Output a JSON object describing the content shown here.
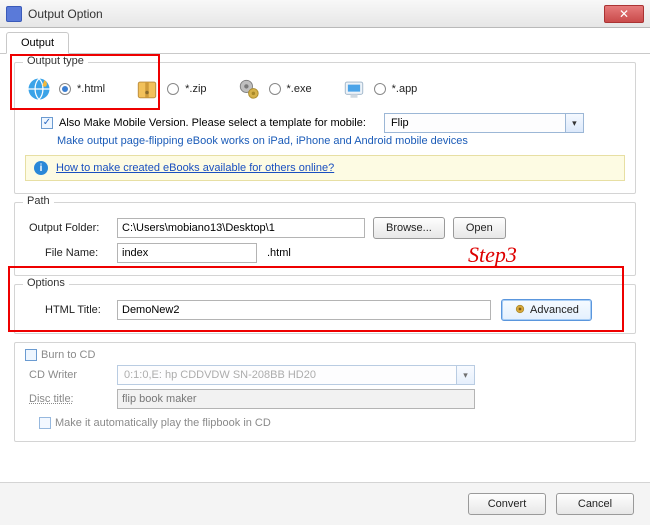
{
  "window": {
    "title": "Output Option"
  },
  "tabs": {
    "output": "Output"
  },
  "output_type": {
    "legend": "Output type",
    "html": "*.html",
    "zip": "*.zip",
    "exe": "*.exe",
    "app": "*.app",
    "selected": "html",
    "mobile_check": "Also Make Mobile Version. Please select a template for mobile:",
    "mobile_hint": "Make output page-flipping eBook works on iPad, iPhone and Android mobile devices",
    "mobile_template": "Flip",
    "info_link": "How to make created eBooks available for others online?"
  },
  "path": {
    "legend": "Path",
    "folder_label": "Output Folder:",
    "folder_value": "C:\\Users\\mobiano13\\Desktop\\1",
    "browse": "Browse...",
    "open": "Open",
    "filename_label": "File Name:",
    "filename_value": "index",
    "filename_ext": ".html"
  },
  "options": {
    "legend": "Options",
    "htmltitle_label": "HTML Title:",
    "htmltitle_value": "DemoNew2",
    "advanced": "Advanced"
  },
  "burn": {
    "check_label": "Burn to CD",
    "cdwriter_label": "CD Writer",
    "cdwriter_value": "0:1:0,E: hp     CDDVDW SN-208BB  HD20",
    "disctitle_label": "Disc title:",
    "disctitle_value": "flip book maker",
    "autoplay_label": "Make it automatically play the flipbook in CD"
  },
  "footer": {
    "convert": "Convert",
    "cancel": "Cancel"
  },
  "annotation": {
    "step3": "Step3"
  }
}
